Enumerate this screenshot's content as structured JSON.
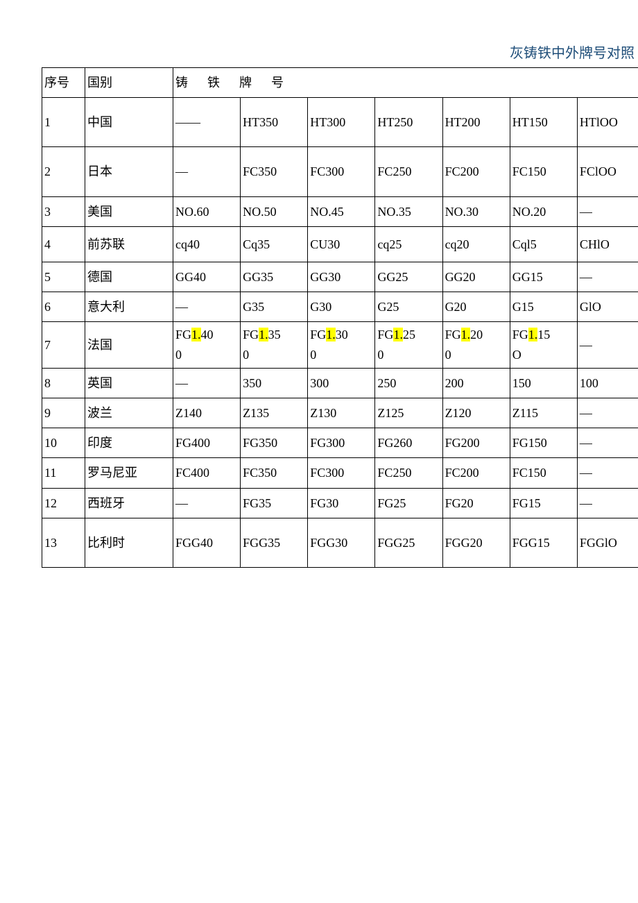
{
  "title": "灰铸铁中外牌号对照",
  "headers": {
    "seq": "序号",
    "country": "国别",
    "grade_label": "铸铁牌号"
  },
  "rows": [
    {
      "seq": "1",
      "country": "中国",
      "c1": "——",
      "c2": "HT350",
      "c3": "HT300",
      "c4": "HT250",
      "c5": "HT200",
      "c6": "HT150",
      "c7": "HTlOO"
    },
    {
      "seq": "2",
      "country": "日本",
      "c1": "—",
      "c2": "FC350",
      "c3": "FC300",
      "c4": "FC250",
      "c5": "FC200",
      "c6": "FC150",
      "c7": "FClOO"
    },
    {
      "seq": "3",
      "country": "美国",
      "c1": "NO.60",
      "c2": "NO.50",
      "c3": "NO.45",
      "c4": "NO.35",
      "c5": "NO.30",
      "c6": "NO.20",
      "c7": "—"
    },
    {
      "seq": "4",
      "country": "前苏联",
      "c1": "cq40",
      "c2": "Cq35",
      "c3": "CU30",
      "c4": "cq25",
      "c5": "cq20",
      "c6": "Cql5",
      "c7": "CHlO"
    },
    {
      "seq": "5",
      "country": "德国",
      "c1": "GG40",
      "c2": "GG35",
      "c3": "GG30",
      "c4": "GG25",
      "c5": "GG20",
      "c6": "GG15",
      "c7": "—"
    },
    {
      "seq": "6",
      "country": "意大利",
      "c1": "—",
      "c2": "G35",
      "c3": "G30",
      "c4": "G25",
      "c5": "G20",
      "c6": "G15",
      "c7": "GlO"
    },
    {
      "seq": "7",
      "country": "法国",
      "c1": {
        "pre": "FG",
        "hl": "1.",
        "mid": "40",
        "post": "0"
      },
      "c2": {
        "pre": "FG",
        "hl": "1.",
        "mid": "35",
        "post": "0"
      },
      "c3": {
        "pre": "FG",
        "hl": "1.",
        "mid": "30",
        "post": "0"
      },
      "c4": {
        "pre": "FG",
        "hl": "1.",
        "mid": "25",
        "post": "0"
      },
      "c5": {
        "pre": "FG",
        "hl": "1.",
        "mid": "20",
        "post": "0"
      },
      "c6": {
        "pre": "FG",
        "hl": "1.",
        "mid": "15",
        "post": "O"
      },
      "c7": "—"
    },
    {
      "seq": "8",
      "country": "英国",
      "c1": "—",
      "c2": "350",
      "c3": "300",
      "c4": "250",
      "c5": "200",
      "c6": "150",
      "c7": "100"
    },
    {
      "seq": "9",
      "country": "波兰",
      "c1": "Z140",
      "c2": "Z135",
      "c3": "Z130",
      "c4": "Z125",
      "c5": "Z120",
      "c6": "Z115",
      "c7": "—"
    },
    {
      "seq": "10",
      "country": "印度",
      "c1": "FG400",
      "c2": "FG350",
      "c3": "FG300",
      "c4": "FG260",
      "c5": "FG200",
      "c6": "FG150",
      "c7": "—"
    },
    {
      "seq": "11",
      "country": "罗马尼亚",
      "c1": "FC400",
      "c2": "FC350",
      "c3": "FC300",
      "c4": "FC250",
      "c5": "FC200",
      "c6": "FC150",
      "c7": "—"
    },
    {
      "seq": "12",
      "country": "西班牙",
      "c1": "—",
      "c2": "FG35",
      "c3": "FG30",
      "c4": "FG25",
      "c5": "FG20",
      "c6": "FG15",
      "c7": "—"
    },
    {
      "seq": "13",
      "country": "比利时",
      "c1": "FGG40",
      "c2": "FGG35",
      "c3": "FGG30",
      "c4": "FGG25",
      "c5": "FGG20",
      "c6": "FGG15",
      "c7": "FGGlO"
    }
  ]
}
